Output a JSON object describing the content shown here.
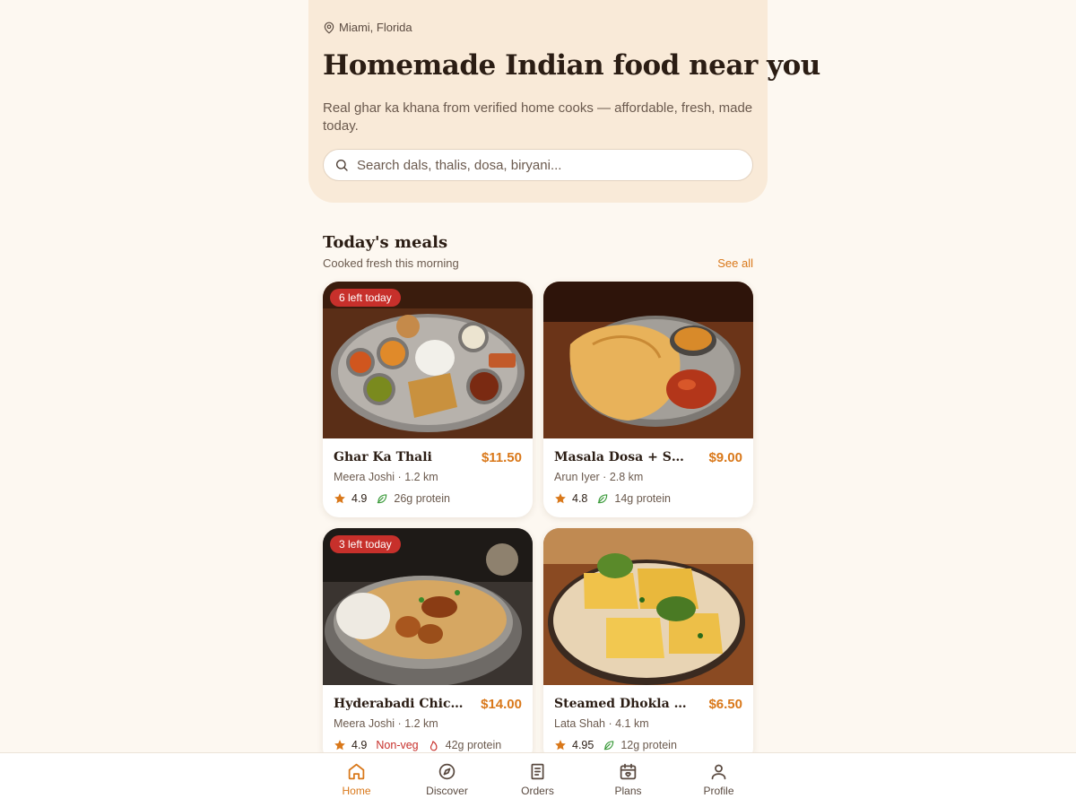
{
  "header": {
    "location": "Miami, Florida",
    "title": "Homemade Indian food near you",
    "subtitle": "Real ghar ka khana from verified home cooks — affordable, fresh, made today.",
    "search_placeholder": "Search dals, thalis, dosa, biryani..."
  },
  "section": {
    "title": "Today's meals",
    "subtitle": "Cooked fresh this morning",
    "see_all": "See all"
  },
  "meals": [
    {
      "name": "Ghar Ka Thali",
      "price": "$11.50",
      "cook": "Meera Joshi · 1.2 km",
      "rating": "4.9",
      "protein": "26g protein",
      "badge": "6 left today",
      "tag": ""
    },
    {
      "name": "Masala Dosa + Sambar",
      "price": "$9.00",
      "cook": "Arun Iyer · 2.8 km",
      "rating": "4.8",
      "protein": "14g protein",
      "badge": "",
      "tag": ""
    },
    {
      "name": "Hyderabadi Chicke...",
      "price": "$14.00",
      "cook": "Meera Joshi · 1.2 km",
      "rating": "4.9",
      "protein": "42g protein",
      "badge": "3 left today",
      "tag": "Non-veg"
    },
    {
      "name": "Steamed Dhokla Box",
      "price": "$6.50",
      "cook": "Lata Shah · 4.1 km",
      "rating": "4.95",
      "protein": "12g protein",
      "badge": "",
      "tag": ""
    }
  ],
  "nav": [
    {
      "label": "Home",
      "icon": "home-icon",
      "active": true
    },
    {
      "label": "Discover",
      "icon": "compass-icon",
      "active": false
    },
    {
      "label": "Orders",
      "icon": "receipt-icon",
      "active": false
    },
    {
      "label": "Plans",
      "icon": "calendar-heart-icon",
      "active": false
    },
    {
      "label": "Profile",
      "icon": "user-icon",
      "active": false
    }
  ],
  "colors": {
    "accent": "#d9781a",
    "badge": "#c7302b",
    "hero_bg": "#f9ead8",
    "page_bg": "#fdf8f1",
    "veg_green": "#3a9a3a"
  }
}
